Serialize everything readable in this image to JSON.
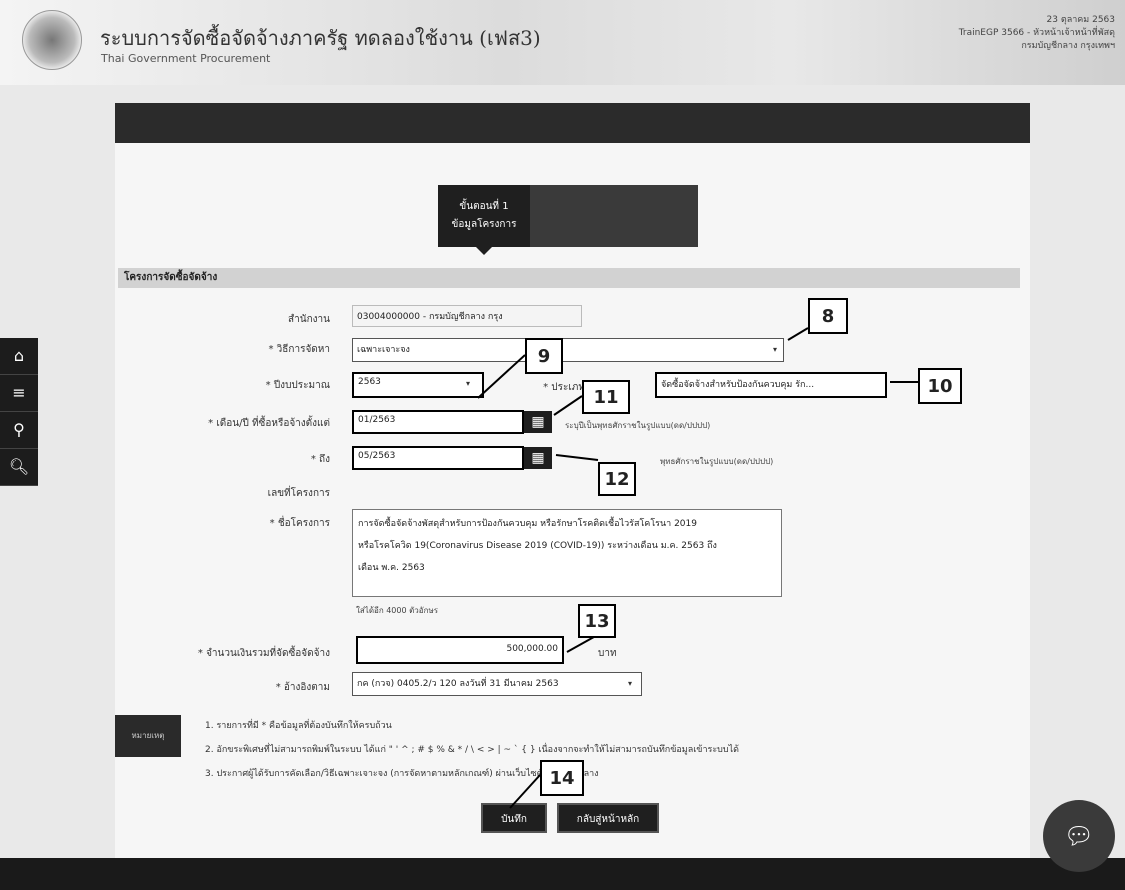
{
  "header": {
    "title": "ระบบการจัดซื้อจัดจ้างภาครัฐ ทดลองใช้งาน (เฟส3)",
    "subtitle": "Thai Government Procurement",
    "date": "23 ตุลาคม 2563",
    "user_line1": "TrainEGP 3566 - หัวหน้าเจ้าหน้าที่พัสดุ",
    "user_line2": "กรมบัญชีกลาง กรุงเทพฯ"
  },
  "steps": {
    "step1_line1": "ขั้นตอนที่ 1",
    "step1_line2": "ข้อมูลโครงการ"
  },
  "section": {
    "title": "โครงการจัดซื้อจัดจ้าง"
  },
  "form": {
    "agency_label": "สำนักงาน",
    "agency_value": "03004000000 - กรมบัญชีกลาง กรุง",
    "method_label": "* วิธีการจัดหา",
    "method_value": "เฉพาะเจาะจง",
    "budget_year_label": "* ปีงบประมาณ",
    "budget_year_value": "2563",
    "type_label": "* ประเภท",
    "type_value": "จัดซื้อจัดจ้างสำหรับป้องกันควบคุม รัก...",
    "start_label": "* เดือน/ปี ที่ซื้อหรือจ้างตั้งแต่",
    "start_value": "01/2563",
    "start_note": "ระบุปีเป็นพุทธศักราชในรูปแบบ(ดด/ปปปป)",
    "end_label": "* ถึง",
    "end_value": "05/2563",
    "end_note": "พุทธศักราชในรูปแบบ(ดด/ปปปป)",
    "project_no_label": "เลขที่โครงการ",
    "project_name_label": "* ชื่อโครงการ",
    "project_name_value": "การจัดซื้อจัดจ้างพัสดุสำหรับการป้องกันควบคุม หรือรักษาโรคติดเชื้อไวรัสโคโรนา 2019\nหรือโรคโควิด 19(Coronavirus Disease 2019 (COVID-19)) ระหว่างเดือน ม.ค. 2563 ถึง\nเดือน พ.ค. 2563",
    "project_name_note": "ใส่ได้อีก 4000 ตัวอักษร",
    "amount_label": "* จำนวนเงินรวมที่จัดซื้อจัดจ้าง",
    "amount_value": "500,000.00",
    "amount_unit": "บาท",
    "reference_label": "* อ้างอิงตาม",
    "reference_value": "กค (กวจ) 0405.2/ว 120 ลงวันที่ 31 มีนาคม 2563"
  },
  "remarks": {
    "badge": "หมายเหตุ",
    "line1": "1. รายการที่มี * คือข้อมูลที่ต้องบันทึกให้ครบถ้วน",
    "line2": "2. อักขระพิเศษที่ไม่สามารถพิมพ์ในระบบ ได้แก่ \" ' ^ ; # $ % & * / \\ < > | ~ ` { } เนื่องจากจะทำให้ไม่สามารถบันทึกข้อมูลเข้าระบบได้",
    "line3": "3. ประกาศผู้ได้รับการคัดเลือก/วิธีเฉพาะเจาะจง (การจัดหาตามหลักเกณฑ์) ผ่านเว็บไซต์กรมบัญชีกลาง"
  },
  "buttons": {
    "save": "บันทึก",
    "back": "กลับสู่หน้าหลัก"
  },
  "callouts": [
    "8",
    "9",
    "10",
    "11",
    "12",
    "13",
    "14"
  ],
  "sidebar_icons": [
    "home-icon",
    "menu-icon",
    "search-list-icon",
    "search-icon"
  ]
}
